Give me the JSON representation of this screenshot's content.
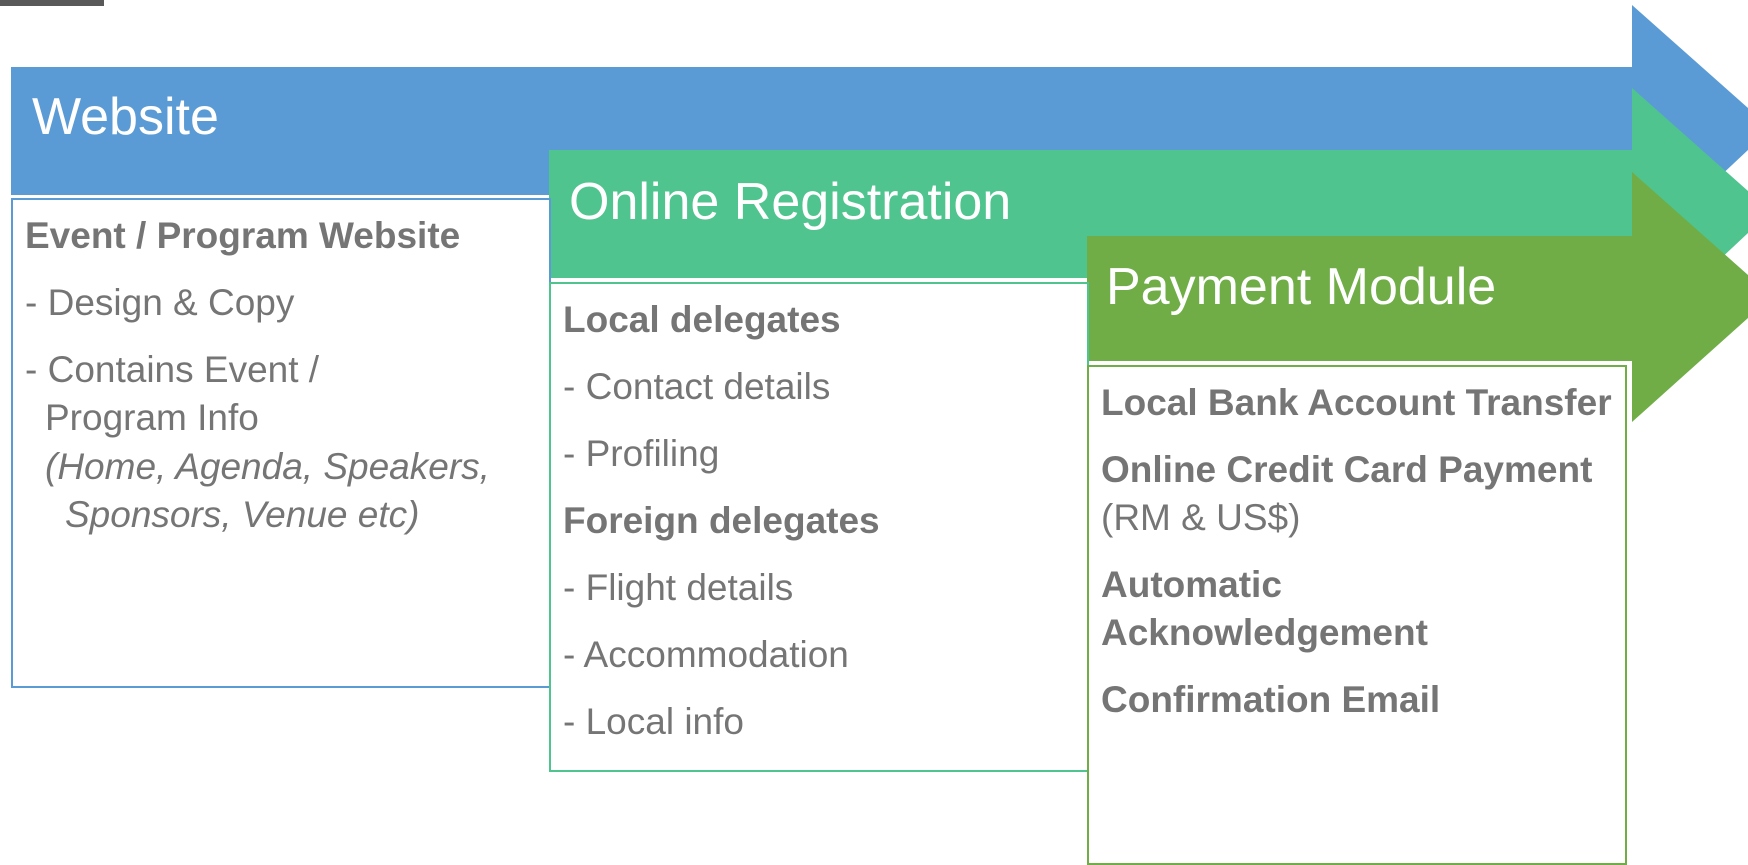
{
  "colors": {
    "website_arrow": "#5B9BD5",
    "registration_arrow": "#4FC48E",
    "payment_arrow": "#70AD47",
    "body_text": "#757575"
  },
  "stages": [
    {
      "title": "Website",
      "heading": "Event / Program Website",
      "items": [
        "- Design & Copy",
        "- Contains Event /",
        "Program Info"
      ],
      "note_line1": "(Home, Agenda, Speakers,",
      "note_line2": "Sponsors, Venue etc)"
    },
    {
      "title": "Online Registration",
      "local_heading": "Local delegates",
      "local_items": [
        "- Contact details",
        "- Profiling"
      ],
      "foreign_heading": "Foreign delegates",
      "foreign_items": [
        "- Flight details",
        "- Accommodation",
        "- Local info"
      ]
    },
    {
      "title": "Payment Module",
      "bank_transfer": "Local Bank Account Transfer",
      "credit_card": "Online Credit Card Payment",
      "currency": "(RM & US$)",
      "ack_line1": "Automatic",
      "ack_line2": "Acknowledgement",
      "confirmation": "Confirmation Email"
    }
  ]
}
